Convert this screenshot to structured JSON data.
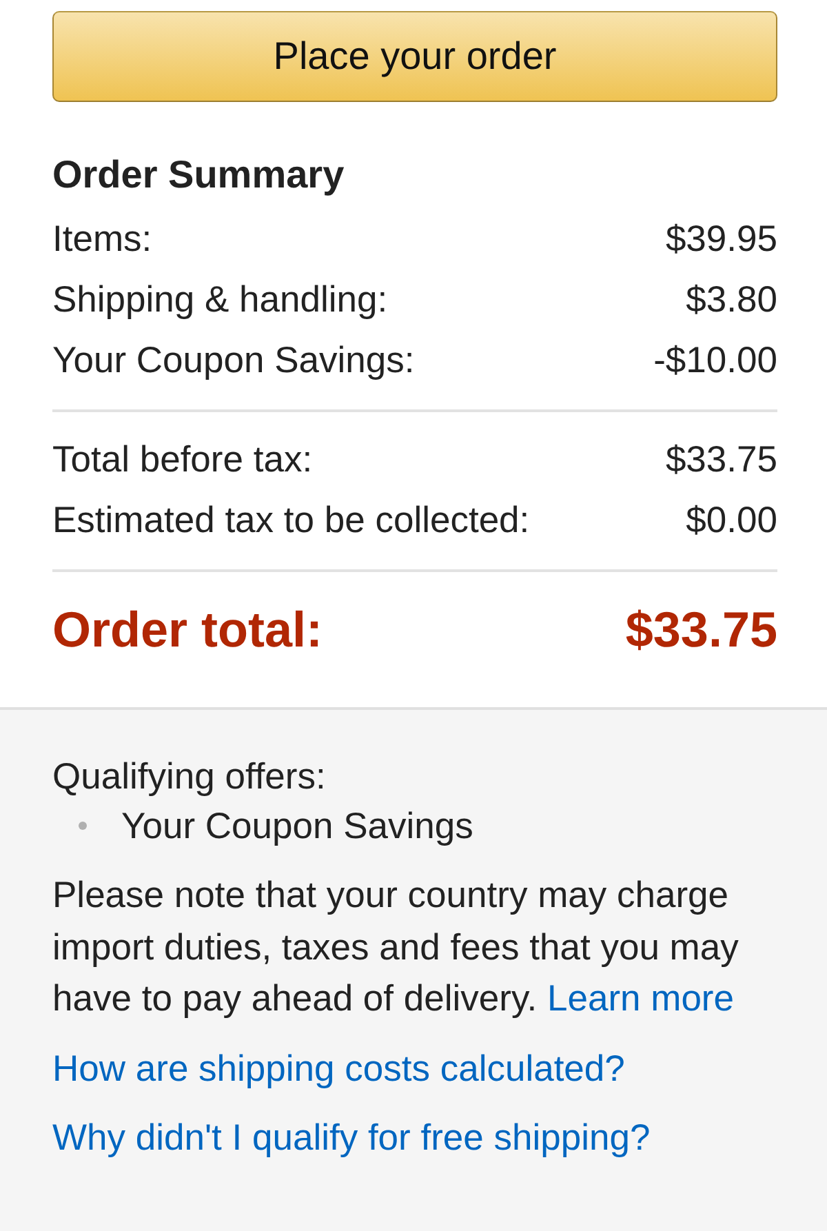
{
  "place_order_button": "Place your order",
  "order_summary": {
    "title": "Order Summary",
    "sections": [
      {
        "rows": [
          {
            "label": "Items:",
            "amount": "$39.95"
          },
          {
            "label": "Shipping & handling:",
            "amount": "$3.80"
          },
          {
            "label": "Your Coupon Savings:",
            "amount": "-$10.00"
          }
        ]
      },
      {
        "rows": [
          {
            "label": "Total before tax:",
            "amount": "$33.75"
          },
          {
            "label": "Estimated tax to be collected:",
            "amount": "$0.00"
          }
        ]
      }
    ],
    "total": {
      "label": "Order total:",
      "amount": "$33.75"
    }
  },
  "info": {
    "qualifying_label": "Qualifying offers:",
    "offers": [
      "Your Coupon Savings"
    ],
    "note": "Please note that your country may charge import duties, taxes and fees that you may have to pay ahead of delivery.",
    "note_link": "Learn more",
    "links": [
      "How are shipping costs calculated?",
      "Why didn't I qualify for free shipping?"
    ]
  }
}
